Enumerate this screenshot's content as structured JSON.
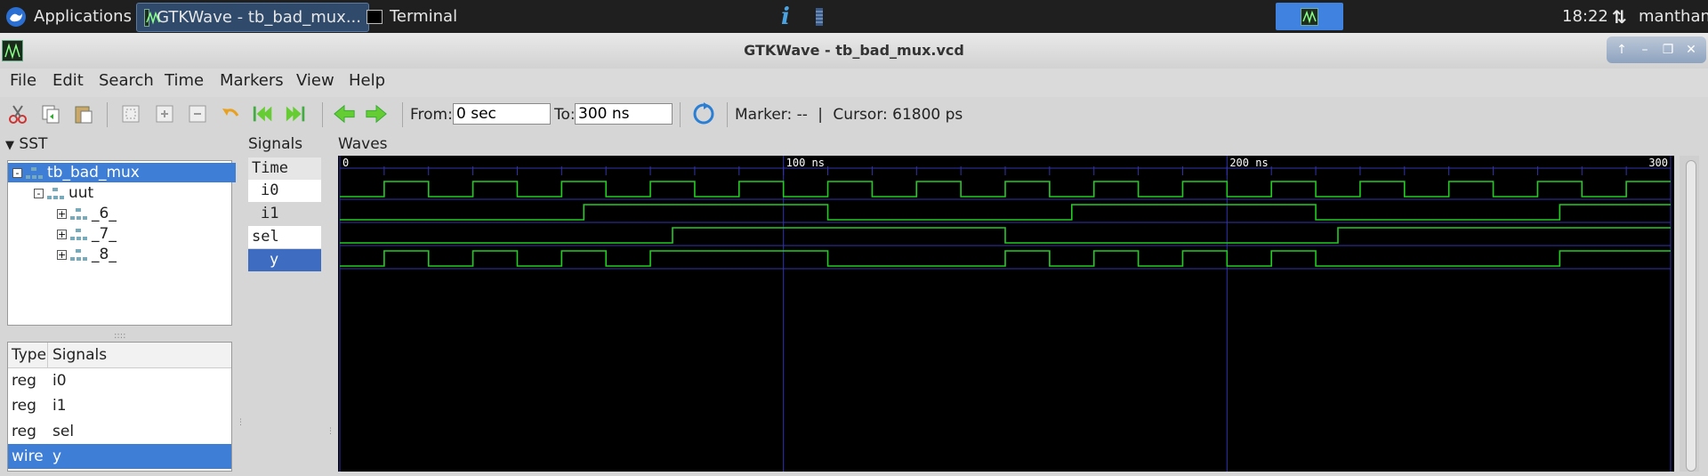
{
  "taskbar": {
    "applications_label": "Applications",
    "tasks": [
      {
        "label": "GTKWave - tb_bad_mux...",
        "active": true
      },
      {
        "label": "Terminal",
        "active": false
      }
    ],
    "clock": "18:22",
    "user": "manthan"
  },
  "window": {
    "title": "GTKWave - tb_bad_mux.vcd"
  },
  "menu": [
    "File",
    "Edit",
    "Search",
    "Time",
    "Markers",
    "View",
    "Help"
  ],
  "toolbar": {
    "from_label": "From:",
    "from_value": "0 sec",
    "to_label": "To:",
    "to_value": "300 ns",
    "marker_text": "Marker: --",
    "divider": "|",
    "cursor_text": "Cursor: 61800 ps"
  },
  "sst": {
    "label": "SST",
    "tree": [
      {
        "label": "tb_bad_mux",
        "level": 0,
        "expander": "-",
        "selected": true
      },
      {
        "label": "uut",
        "level": 1,
        "expander": "-",
        "selected": false
      },
      {
        "label": "_6_",
        "level": 2,
        "expander": "+",
        "selected": false
      },
      {
        "label": "_7_",
        "level": 2,
        "expander": "+",
        "selected": false
      },
      {
        "label": "_8_",
        "level": 2,
        "expander": "+",
        "selected": false
      }
    ],
    "table": {
      "headers": {
        "type": "Type",
        "signals": "Signals"
      },
      "rows": [
        {
          "type": "reg",
          "name": "i0",
          "selected": false
        },
        {
          "type": "reg",
          "name": "i1",
          "selected": false
        },
        {
          "type": "reg",
          "name": "sel",
          "selected": false
        },
        {
          "type": "wire",
          "name": "y",
          "selected": true
        }
      ]
    }
  },
  "signals_pane": {
    "label": "Signals",
    "rows": [
      {
        "label": "Time",
        "kind": "time"
      },
      {
        "label": "i0",
        "kind": "white"
      },
      {
        "label": "i1",
        "kind": "plain"
      },
      {
        "label": "sel",
        "kind": "white"
      },
      {
        "label": "y",
        "kind": "sel"
      }
    ]
  },
  "waves_pane": {
    "label": "Waves",
    "time_range_ns": [
      0,
      300
    ],
    "major_ticks": [
      {
        "t": 0,
        "label": "0"
      },
      {
        "t": 100,
        "label": "100 ns"
      },
      {
        "t": 200,
        "label": "200 ns"
      },
      {
        "t": 300,
        "label": "300"
      }
    ],
    "minor_tick_step_ns": 10,
    "colors": {
      "background": "#000000",
      "trace": "#22cc22",
      "grid": "#3333aa",
      "text": "#ffffff"
    },
    "signals": [
      {
        "name": "i0",
        "initial": 0,
        "toggles": [
          10,
          20,
          30,
          40,
          50,
          60,
          70,
          80,
          90,
          100,
          110,
          120,
          130,
          140,
          150,
          160,
          170,
          180,
          190,
          200,
          210,
          220,
          230,
          240,
          250,
          260,
          270,
          280,
          290
        ]
      },
      {
        "name": "i1",
        "initial": 0,
        "toggles": [
          55,
          110,
          165,
          220,
          275
        ]
      },
      {
        "name": "sel",
        "initial": 0,
        "toggles": [
          75,
          150,
          225
        ]
      },
      {
        "name": "y",
        "initial": 0,
        "toggles": [
          10,
          20,
          30,
          40,
          50,
          60,
          70,
          110,
          150,
          160,
          170,
          180,
          190,
          200,
          210,
          220,
          275
        ]
      }
    ]
  }
}
